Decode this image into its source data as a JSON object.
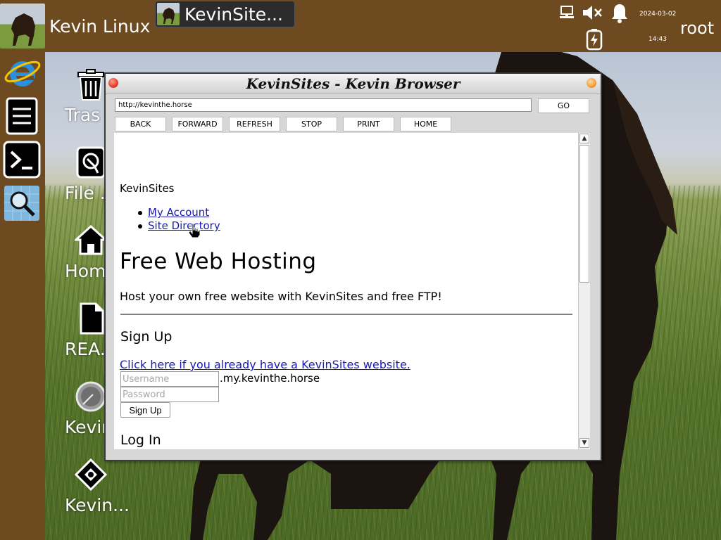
{
  "topbar": {
    "menu_label": "Kevin Linux",
    "task_label": "KevinSite...",
    "date": "2024-03-02",
    "time": "14:43",
    "user": "root",
    "icons": [
      "network-icon",
      "volume-muted-icon",
      "notification-bell-icon",
      "battery-charging-icon"
    ]
  },
  "dock": {
    "items": [
      "internet-explorer-icon",
      "file-cabinet-icon",
      "terminal-icon",
      "search-icon"
    ]
  },
  "desktop": {
    "icons": [
      {
        "name": "trash",
        "label": "Tras",
        "icon": "trash-icon"
      },
      {
        "name": "file-manager",
        "label": "File ...",
        "icon": "file-manager-icon"
      },
      {
        "name": "home",
        "label": "Hom",
        "icon": "home-icon"
      },
      {
        "name": "readme",
        "label": "REA...",
        "icon": "document-icon"
      },
      {
        "name": "kevin-browser",
        "label": "Kevir",
        "icon": "compass-icon"
      },
      {
        "name": "kevin-app",
        "label": "Kevin...",
        "icon": "puzzle-icon"
      }
    ]
  },
  "browser": {
    "title": "KevinSites - Kevin Browser",
    "url": "http://kevinthe.horse",
    "go_label": "GO",
    "nav_buttons": [
      "BACK",
      "FORWARD",
      "REFRESH",
      "STOP",
      "PRINT",
      "HOME"
    ]
  },
  "page": {
    "site_name": "KevinSites",
    "nav_links": [
      "My Account",
      "Site Directory"
    ],
    "heading": "Free Web Hosting",
    "lead": "Host your own free website with KevinSites and free FTP!",
    "signup_heading": "Sign Up",
    "existing_link": "Click here if you already have a KevinSites website.",
    "username_placeholder": "Username",
    "domain_suffix": ".my.kevinthe.horse",
    "password_placeholder": "Password",
    "signup_button": "Sign Up",
    "login_heading": "Log In"
  },
  "colors": {
    "panel": "#6e4a20",
    "link": "#1a1ab5",
    "close_button": "#e2402a",
    "minimize_button": "#f3a03a"
  }
}
